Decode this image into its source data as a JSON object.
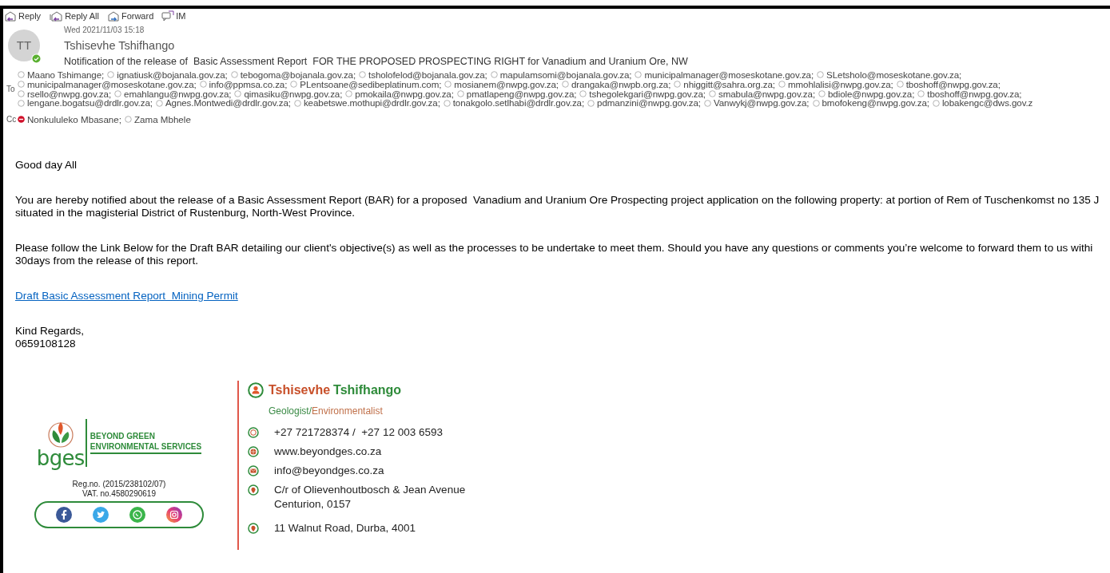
{
  "toolbar": [
    {
      "kind": "reply",
      "label": "Reply"
    },
    {
      "kind": "reply-all",
      "label": "Reply All"
    },
    {
      "kind": "forward",
      "label": "Forward"
    },
    {
      "kind": "im",
      "label": "IM"
    }
  ],
  "message": {
    "date": "Wed 2021/11/03 15:18",
    "avatar_initials": "TT",
    "sender_online": true,
    "sender": "Tshisevhe Tshifhango",
    "subject": "Notification of the release of  Basic Assessment Report  FOR THE PROPOSED PROSPECTING RIGHT for Vanadium and Uranium Ore, NW"
  },
  "to_label": "To",
  "to_rows": [
    [
      {
        "name": "Maano Tshimange;",
        "busy": false
      },
      {
        "name": "ignatiusk@bojanala.gov.za;",
        "busy": false
      },
      {
        "name": "tebogoma@bojanala.gov.za;",
        "busy": false
      },
      {
        "name": "tsholofelod@bojanala.gov.za;",
        "busy": false
      },
      {
        "name": "mapulamsomi@bojanala.gov.za;",
        "busy": false
      },
      {
        "name": "municipalmanager@moseskotane.gov.za;",
        "busy": false
      },
      {
        "name": "SLetsholo@moseskotane.gov.za;",
        "busy": false
      }
    ],
    [
      {
        "name": "municipalmanager@moseskotane.gov.za;",
        "busy": false
      },
      {
        "name": "info@ppmsa.co.za;",
        "busy": false
      },
      {
        "name": "PLentsoane@sedibeplatinum.com;",
        "busy": false
      },
      {
        "name": "mosianem@nwpg.gov.za;",
        "busy": false
      },
      {
        "name": "drangaka@nwpb.org.za;",
        "busy": false
      },
      {
        "name": "nhiggitt@sahra.org.za;",
        "busy": false
      },
      {
        "name": "mmohlalisi@nwpg.gov.za;",
        "busy": false
      },
      {
        "name": "tboshoff@nwpg.gov.za;",
        "busy": false
      }
    ],
    [
      {
        "name": "rsello@nwpg.gov.za;",
        "busy": false
      },
      {
        "name": "emahlangu@nwpg.gov.za;",
        "busy": false
      },
      {
        "name": "qimasiku@nwpg.gov.za;",
        "busy": false
      },
      {
        "name": "pmokaila@nwpg.gov.za;",
        "busy": false
      },
      {
        "name": "pmatlapeng@nwpg.gov.za;",
        "busy": false
      },
      {
        "name": "tshegolekgari@nwpg.gov.za;",
        "busy": false
      },
      {
        "name": "smabula@nwpg.gov.za;",
        "busy": false
      },
      {
        "name": "bdiole@nwpg.gov.za;",
        "busy": false
      },
      {
        "name": "tboshoff@nwpg.gov.za;",
        "busy": false
      }
    ],
    [
      {
        "name": "lengane.bogatsu@drdlr.gov.za;",
        "busy": false
      },
      {
        "name": "Agnes.Montwedi@drdlr.gov.za;",
        "busy": false
      },
      {
        "name": "keabetswe.mothupi@drdlr.gov.za;",
        "busy": false
      },
      {
        "name": "tonakgolo.setlhabi@drdlr.gov.za;",
        "busy": false
      },
      {
        "name": "pdmanzini@nwpg.gov.za;",
        "busy": false
      },
      {
        "name": "Vanwykj@nwpg.gov.za;",
        "busy": false
      },
      {
        "name": "bmofokeng@nwpg.gov.za;",
        "busy": false
      },
      {
        "name": "lobakengc@dws.gov.z",
        "busy": false
      }
    ]
  ],
  "cc_label": "Cc",
  "cc": [
    {
      "name": "Nonkululeko Mbasane;",
      "busy": true
    },
    {
      "name": "Zama Mbhele",
      "busy": false
    }
  ],
  "body": [
    {
      "kind": "text",
      "lines": [
        "Good day All"
      ]
    },
    {
      "kind": "text",
      "lines": [
        "You are hereby notified about the release of a Basic Assessment Report (BAR) for a proposed  Vanadium and Uranium Ore Prospecting project application on the following property: at portion of Rem of Tuschenkomst no 135 J",
        "situated in the magisterial District of Rustenburg, North-West Province."
      ]
    },
    {
      "kind": "text",
      "lines": [
        "Please follow the Link Below for the Draft BAR detailing our client's objective(s) as well as the processes to be undertake to meet them. Should you have any questions or comments you’re welcome to forward them to us withi",
        "30days from the release of this report."
      ]
    },
    {
      "kind": "link",
      "lines": [
        "Draft Basic Assessment Report  Mining Permit"
      ]
    },
    {
      "kind": "text",
      "lines": [
        "Kind Regards,",
        "0659108128"
      ]
    }
  ],
  "signature": {
    "company_line1": "BEYOND GREEN",
    "company_line2": "ENVIRONMENTAL SERVICES",
    "logo_text": "bges",
    "reg": "Reg.no. (2015/238102/07)",
    "vat": "VAT. no.4580290619",
    "first_name": "Tshisevhe",
    "last_name": "Tshifhango",
    "title_part1": "Geologist/",
    "title_part2": "Environmentalist",
    "contacts": [
      {
        "kind": "whatsapp",
        "lines": [
          "+27 721728374 /  +27 12 003 6593"
        ]
      },
      {
        "kind": "web",
        "lines": [
          "www.beyondges.co.za"
        ]
      },
      {
        "kind": "mail",
        "lines": [
          "info@beyondges.co.za"
        ]
      },
      {
        "kind": "pin",
        "lines": [
          "C/r of Olievenhoutbosch & Jean Avenue",
          "Centurion, 0157"
        ]
      },
      {
        "kind": "pin",
        "lines": [
          "11 Walnut Road, Durba, 4001"
        ]
      }
    ]
  }
}
